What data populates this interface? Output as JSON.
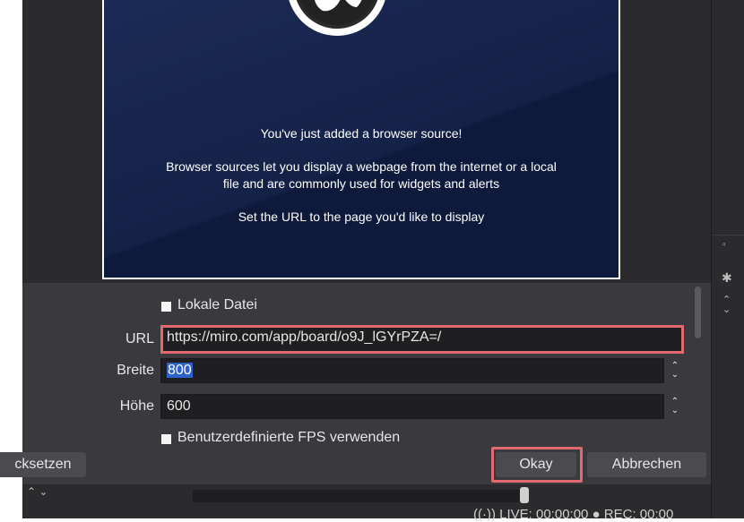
{
  "preview": {
    "line1": "You've just added a browser source!",
    "line2a": "Browser sources let you display a webpage from the internet or a local",
    "line2b": "file and are commonly used for widgets and alerts",
    "line3": "Set the URL to the page you'd like to display"
  },
  "form": {
    "local_file_label": "Lokale Datei",
    "url_label": "URL",
    "url_value": "https://miro.com/app/board/o9J_lGYrPZA=/",
    "width_label": "Breite",
    "width_value": "800",
    "height_label": "Höhe",
    "height_value": "600",
    "custom_fps_label": "Benutzerdefinierte FPS verwenden"
  },
  "buttons": {
    "reset": "cksetzen",
    "okay": "Okay",
    "cancel": "Abbrechen"
  },
  "status": {
    "text": "((·)) LIVE: 00:00:00  ●  REC: 00:00"
  },
  "colors": {
    "highlight": "#e06a6f",
    "preview_bg": "#0e1a3b",
    "dialog_bg": "#3a3a3e",
    "selection": "#2f62c8"
  }
}
